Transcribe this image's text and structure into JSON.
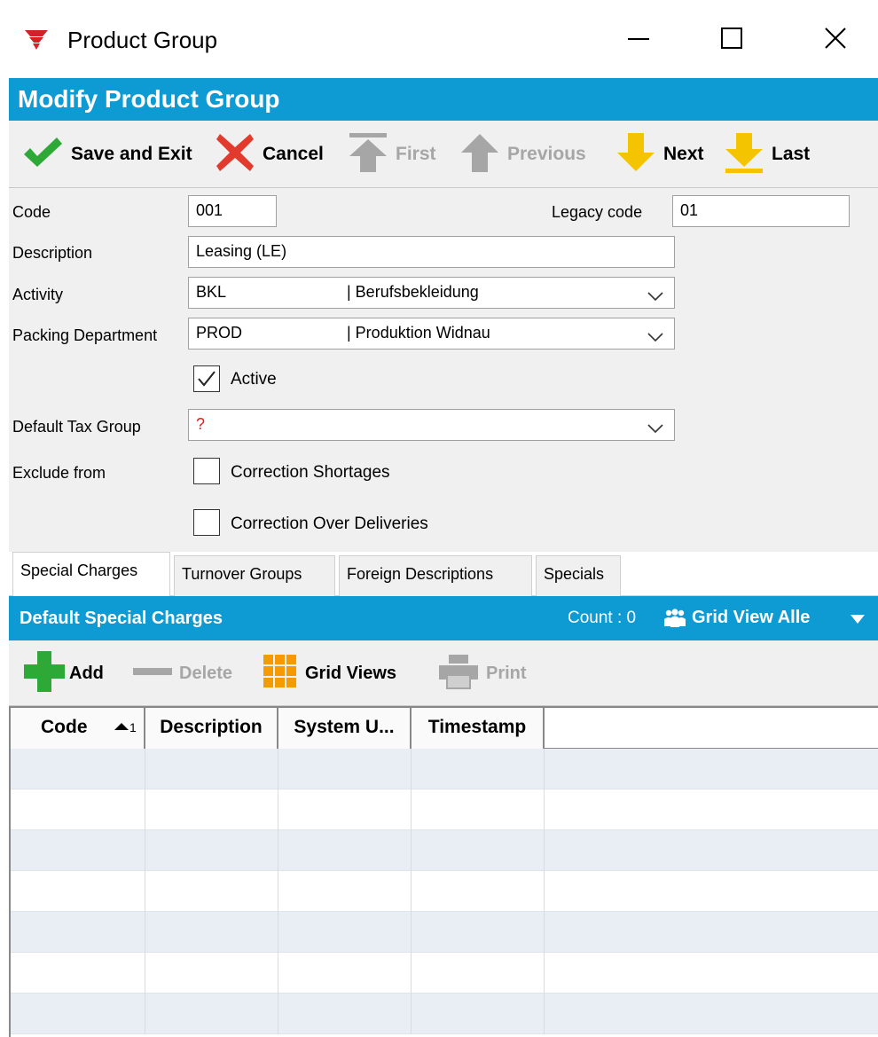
{
  "window": {
    "title": "Product Group",
    "app_icon": "company-logo-icon",
    "controls": [
      "minimize-icon",
      "maximize-icon",
      "close-icon"
    ]
  },
  "header": {
    "title": "Modify Product Group",
    "color": "#0e9ad2"
  },
  "toolbar": {
    "save": "Save and Exit",
    "cancel": "Cancel",
    "first": "First",
    "previous": "Previous",
    "next": "Next",
    "last": "Last"
  },
  "form": {
    "code_label": "Code",
    "code_value": "001",
    "legacy_label": "Legacy code",
    "legacy_value": "01",
    "description_label": "Description",
    "description_value": "Leasing (LE)",
    "activity_label": "Activity",
    "activity_code": "BKL",
    "activity_name": "| Berufsbekleidung",
    "packing_label": "Packing Department",
    "packing_code": "PROD",
    "packing_name": "| Produktion Widnau",
    "active_label": "Active",
    "active_checked": true,
    "tax_label": "Default Tax Group",
    "tax_value": "?",
    "exclude_label": "Exclude from",
    "shortages_label": "Correction Shortages",
    "shortages_checked": false,
    "over_label": "Correction Over Deliveries",
    "over_checked": false
  },
  "tabs": [
    "Special Charges",
    "Turnover Groups",
    "Foreign Descriptions",
    "Specials"
  ],
  "active_tab": "Special Charges",
  "section": {
    "title": "Default Special Charges",
    "count": "Count : 0",
    "grid_view": "Grid View Alle"
  },
  "grid_toolbar": {
    "add": "Add",
    "delete": "Delete",
    "grid_views": "Grid Views",
    "print": "Print"
  },
  "grid": {
    "columns": [
      "Code",
      "Description",
      "System U...",
      "Timestamp"
    ],
    "sort_indicator": "1",
    "rows": []
  }
}
